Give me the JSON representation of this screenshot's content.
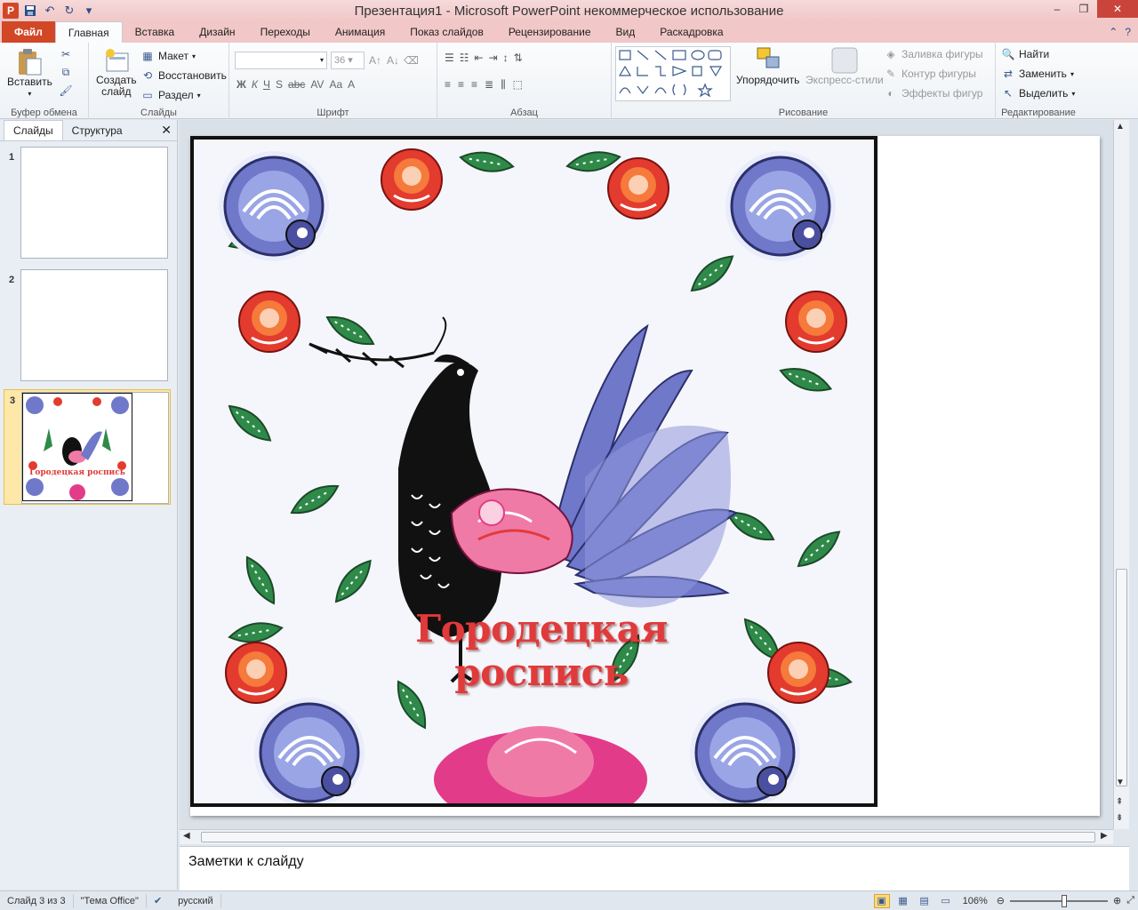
{
  "window": {
    "title": "Презентация1  -  Microsoft PowerPoint некоммерческое использование",
    "controls": {
      "minimize": "–",
      "maximize": "❐",
      "close": "✕"
    }
  },
  "qat": {
    "app_icon": "P",
    "save": "💾",
    "undo": "↶",
    "redo": "↻",
    "more": "▾"
  },
  "tabs": [
    "Файл",
    "Главная",
    "Вставка",
    "Дизайн",
    "Переходы",
    "Анимация",
    "Показ слайдов",
    "Рецензирование",
    "Вид",
    "Раскадровка"
  ],
  "ribbon": {
    "clipboard": {
      "paste": "Вставить",
      "label": "Буфер обмена"
    },
    "slides": {
      "new_slide_1": "Создать",
      "new_slide_2": "слайд",
      "layout": "Макет",
      "reset": "Восстановить",
      "section": "Раздел",
      "label": "Слайды"
    },
    "font": {
      "size": "36",
      "label": "Шрифт"
    },
    "paragraph": {
      "label": "Абзац"
    },
    "drawing": {
      "arrange": "Упорядочить",
      "quick_styles": "Экспресс-стили",
      "fill": "Заливка фигуры",
      "outline": "Контур фигуры",
      "effects": "Эффекты фигур",
      "label": "Рисование"
    },
    "editing": {
      "find": "Найти",
      "replace": "Заменить",
      "select": "Выделить",
      "label": "Редактирование"
    }
  },
  "left_pane": {
    "tabs": [
      "Слайды",
      "Структура"
    ],
    "close": "✕",
    "slides": [
      {
        "number": "1"
      },
      {
        "number": "2"
      },
      {
        "number": "3",
        "caption": "Городецкая роспись"
      }
    ]
  },
  "slide": {
    "title": "Городецкая роспись"
  },
  "notes": {
    "placeholder": "Заметки к слайду"
  },
  "status": {
    "slide_info": "Слайд 3 из 3",
    "theme": "\"Тема Office\"",
    "language": "русский",
    "zoom": "106%"
  },
  "colors": {
    "accent": "#d24726",
    "title_red": "#e03a3a"
  }
}
